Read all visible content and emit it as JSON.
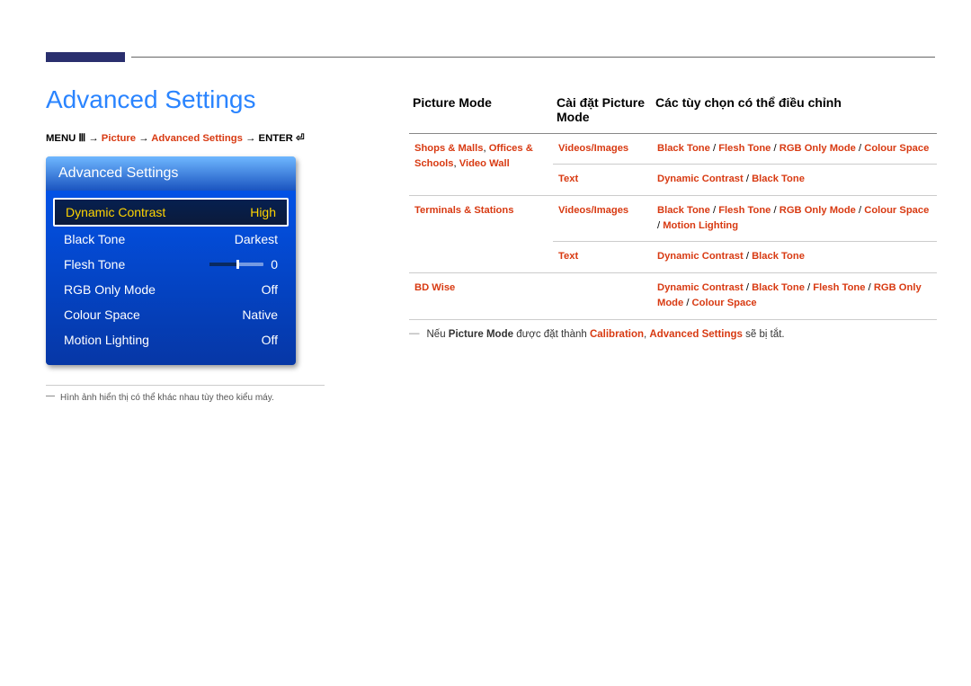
{
  "page_title": "Advanced Settings",
  "menu_path": {
    "prefix": "MENU ",
    "icon": "Ⅲ",
    "arrow": " → ",
    "seg1": "Picture",
    "seg2": "Advanced Settings",
    "seg3": "ENTER ",
    "enter_icon": "⏎"
  },
  "osd": {
    "header": "Advanced Settings",
    "rows": [
      {
        "label": "Dynamic Contrast",
        "value": "High",
        "selected": true
      },
      {
        "label": "Black Tone",
        "value": "Darkest"
      },
      {
        "label": "Flesh Tone",
        "value": "0",
        "slider": true
      },
      {
        "label": "RGB Only Mode",
        "value": "Off"
      },
      {
        "label": "Colour Space",
        "value": "Native"
      },
      {
        "label": "Motion Lighting",
        "value": "Off"
      }
    ]
  },
  "footnote_dash": "―",
  "footnote": "Hình ảnh hiển thị có thể khác nhau tùy theo kiểu máy.",
  "table": {
    "headers": [
      "Picture Mode",
      "Cài đặt Picture Mode",
      "Các tùy chọn có thể điều chỉnh"
    ],
    "rows": [
      {
        "col0": [
          "Shops & Malls",
          "Offices & Schools",
          "Video Wall"
        ],
        "col0_seps": [
          ", ",
          ", "
        ],
        "col1": "Videos/Images",
        "col2": "Black Tone / Flesh Tone / RGB Only Mode / Colour Space"
      },
      {
        "col0": "",
        "col1": "Text",
        "col2": "Dynamic Contrast / Black Tone"
      },
      {
        "col0": [
          "Terminals & Stations"
        ],
        "col0_seps": [],
        "col1": "Videos/Images",
        "col2": "Black Tone / Flesh Tone / RGB Only Mode / Colour Space / Motion Lighting"
      },
      {
        "col0": "",
        "col1": "Text",
        "col2": "Dynamic Contrast / Black Tone"
      },
      {
        "col0": [
          "BD Wise"
        ],
        "col0_seps": [],
        "col1": "",
        "col2": "Dynamic Contrast / Black Tone / Flesh Tone / RGB Only Mode / Colour Space"
      }
    ]
  },
  "bottom_note": {
    "dash": "―",
    "t1": "Nếu ",
    "t2": "Picture Mode",
    "t3": " được đặt thành ",
    "t4": "Calibration",
    "t5": ", ",
    "t6": "Advanced Settings",
    "t7": " sẽ bị tắt."
  }
}
